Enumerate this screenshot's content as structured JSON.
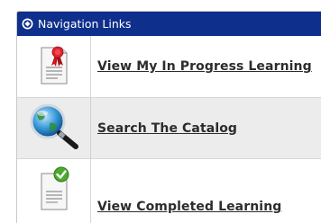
{
  "panel": {
    "title": "Navigation Links",
    "header_color": "#0f2f8c",
    "items": [
      {
        "label": "View My In Progress Learning",
        "icon": "certificate-ribbon-icon"
      },
      {
        "label": "Search The Catalog",
        "icon": "globe-magnifier-icon"
      },
      {
        "label": "View Completed Learning",
        "icon": "document-checkmark-icon"
      }
    ]
  }
}
